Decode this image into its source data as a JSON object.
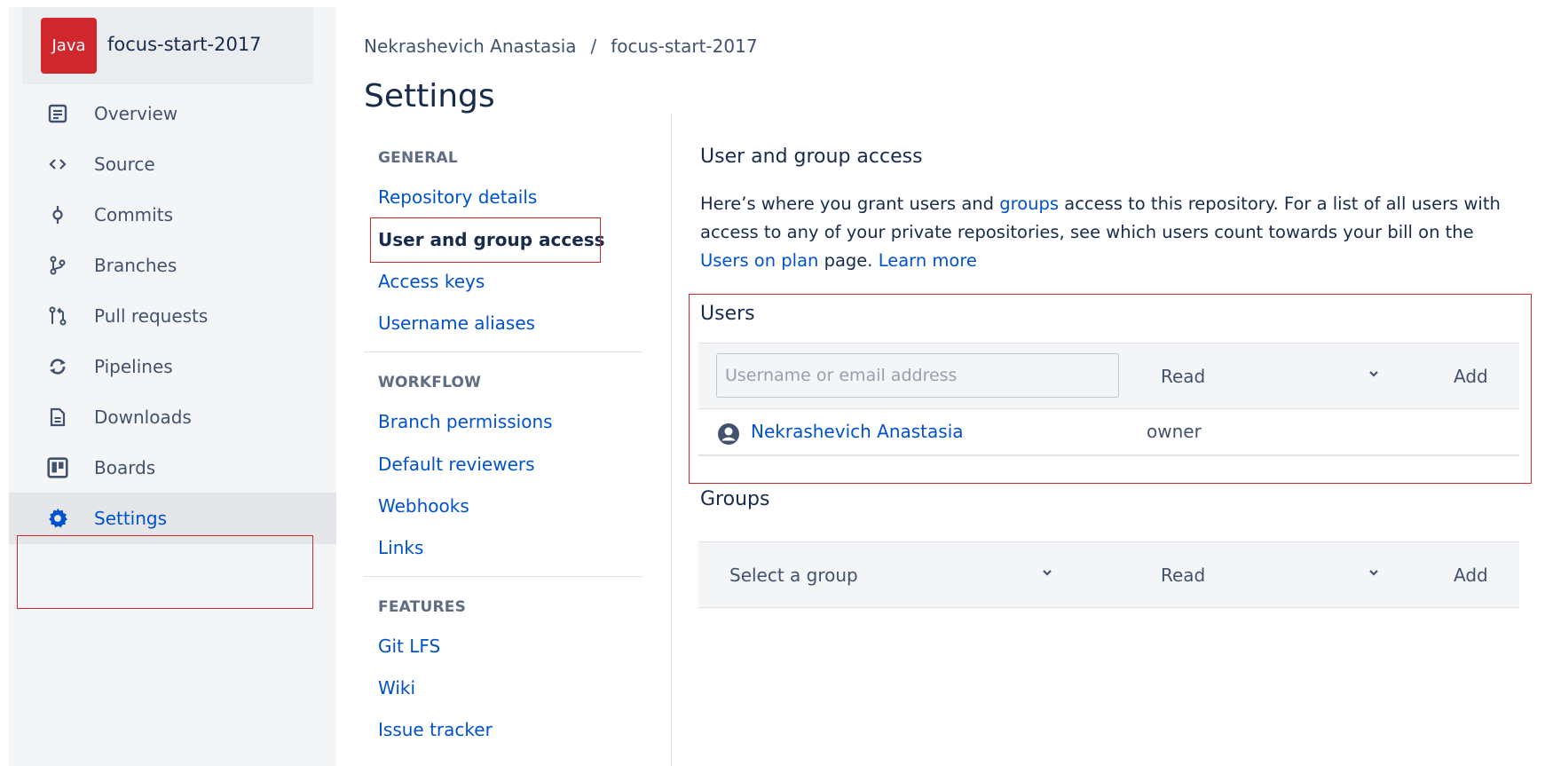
{
  "repo": {
    "language_badge": "Java",
    "name": "focus-start-2017"
  },
  "sidebar": {
    "items": [
      {
        "label": "Overview",
        "icon": "document-icon"
      },
      {
        "label": "Source",
        "icon": "code-icon"
      },
      {
        "label": "Commits",
        "icon": "commit-icon"
      },
      {
        "label": "Branches",
        "icon": "branch-icon"
      },
      {
        "label": "Pull requests",
        "icon": "pull-request-icon"
      },
      {
        "label": "Pipelines",
        "icon": "pipelines-icon"
      },
      {
        "label": "Downloads",
        "icon": "download-icon"
      },
      {
        "label": "Boards",
        "icon": "board-icon"
      },
      {
        "label": "Settings",
        "icon": "gear-icon",
        "active": true
      }
    ]
  },
  "breadcrumb": {
    "owner": "Nekrashevich Anastasia",
    "separator": "/",
    "repo": "focus-start-2017"
  },
  "page_title": "Settings",
  "settings_nav": {
    "general_heading": "GENERAL",
    "general": [
      "Repository details",
      "User and group access",
      "Access keys",
      "Username aliases"
    ],
    "workflow_heading": "WORKFLOW",
    "workflow": [
      "Branch permissions",
      "Default reviewers",
      "Webhooks",
      "Links"
    ],
    "features_heading": "FEATURES",
    "features": [
      "Git LFS",
      "Wiki",
      "Issue tracker"
    ]
  },
  "main": {
    "title": "User and group access",
    "desc": {
      "p1": "Here’s where you grant users and ",
      "groups_link": "groups",
      "p2": " access to this repository. For a list of all users with access to any of your private repositories, see which users count towards your bill on the ",
      "users_on_plan_link": "Users on plan",
      "p3": " page. ",
      "learn_more": "Learn more"
    },
    "users": {
      "heading": "Users",
      "input_placeholder": "Username or email address",
      "permission": "Read",
      "add": "Add",
      "rows": [
        {
          "name": "Nekrashevich Anastasia",
          "role": "owner"
        }
      ]
    },
    "groups": {
      "heading": "Groups",
      "group_select": "Select a group",
      "permission": "Read",
      "add": "Add"
    }
  },
  "colors": {
    "accent": "#0052cc",
    "highlight": "#d0272d",
    "badge": "#d0272d"
  }
}
